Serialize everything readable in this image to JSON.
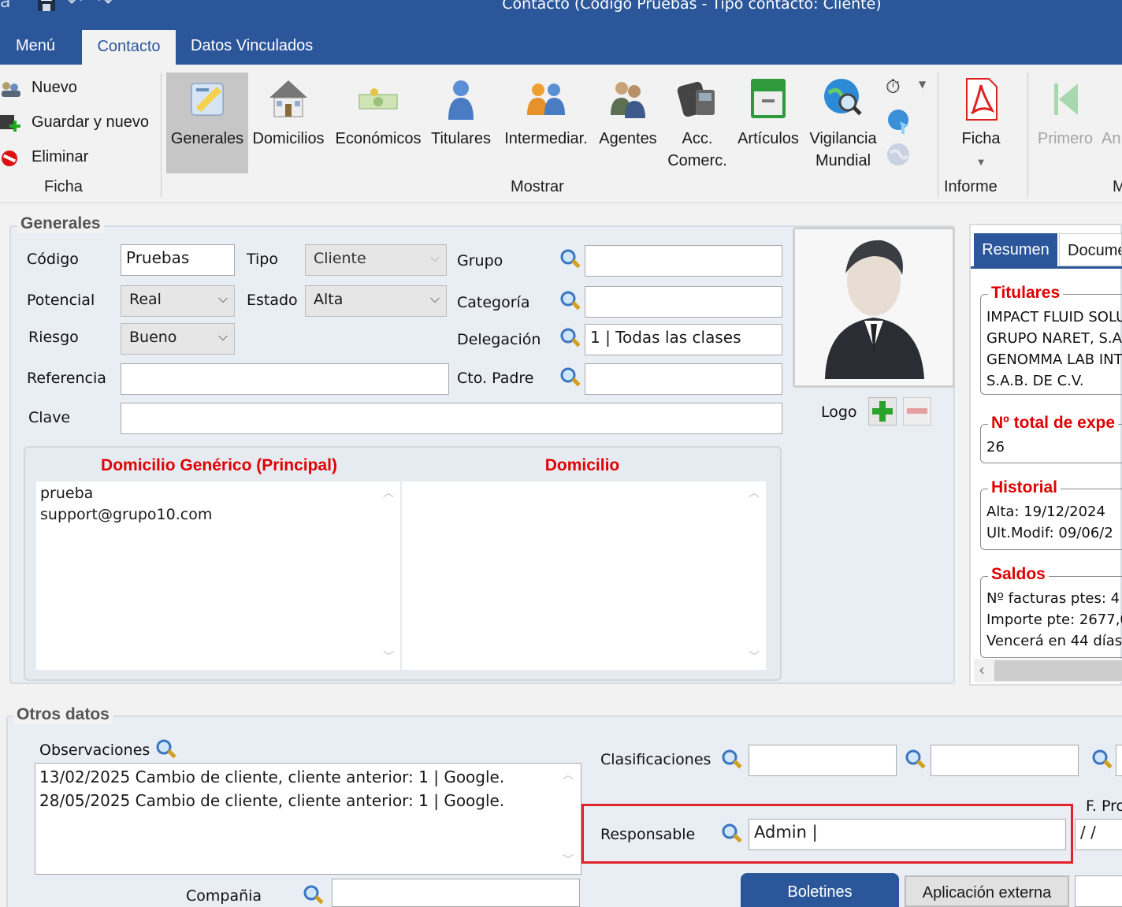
{
  "window": {
    "title": "Contacto (Código Pruebas - Tipo contacto: Cliente)"
  },
  "tabs": [
    {
      "label": "Menú"
    },
    {
      "label": "Contacto"
    },
    {
      "label": "Datos Vinculados"
    }
  ],
  "ribbon": {
    "ficha": {
      "nuevo": "Nuevo",
      "guardar_nuevo": "Guardar y nuevo",
      "eliminar": "Eliminar",
      "group": "Ficha"
    },
    "mostrar": {
      "group": "Mostrar",
      "items": [
        {
          "label": "Generales",
          "icon": "generales-icon"
        },
        {
          "label": "Domicilios",
          "icon": "house-icon"
        },
        {
          "label": "Económicos",
          "icon": "money-icon"
        },
        {
          "label": "Titulares",
          "icon": "person-icon"
        },
        {
          "label": "Intermediar.",
          "icon": "people-icon"
        },
        {
          "label": "Agentes",
          "icon": "agents-icon"
        },
        {
          "label": "Acc.",
          "label2": "Comerc.",
          "icon": "phone-icon"
        },
        {
          "label": "Artículos",
          "icon": "drawer-icon"
        },
        {
          "label": "Vigilancia",
          "label2": "Mundial",
          "icon": "globe-search-icon"
        }
      ]
    },
    "informe": {
      "ficha": "Ficha",
      "group": "Informe"
    },
    "nav": {
      "primero": "Primero",
      "anterior": "An",
      "group": "M"
    }
  },
  "generales": {
    "title": "Generales",
    "codigo_label": "Código",
    "codigo_value": "Pruebas",
    "tipo_label": "Tipo",
    "tipo_value": "Cliente",
    "grupo_label": "Grupo",
    "potencial_label": "Potencial",
    "potencial_value": "Real",
    "estado_label": "Estado",
    "estado_value": "Alta",
    "categoria_label": "Categoría",
    "riesgo_label": "Riesgo",
    "riesgo_value": "Bueno",
    "delegacion_label": "Delegación",
    "delegacion_value": "1 | Todas las clases",
    "referencia_label": "Referencia",
    "cto_padre_label": "Cto. Padre",
    "clave_label": "Clave",
    "logo_label": "Logo",
    "domicilio_generico_title": "Domicilio Genérico (Principal)",
    "domicilio_generico_lines": [
      "prueba",
      "support@grupo10.com"
    ],
    "domicilio_title": "Domicilio"
  },
  "summary": {
    "tabs": [
      "Resumen",
      "Docume"
    ],
    "titulares_title": "Titulares",
    "titulares_lines": [
      "IMPACT FLUID SOLU",
      "GRUPO NARET, S.A.",
      "GENOMMA LAB INT",
      "S.A.B. DE C.V."
    ],
    "total_title": "Nº total de expe",
    "total_value": "26",
    "historial_title": "Historial",
    "alta": "Alta: 19/12/2024",
    "ult_modif": "Ult.Modif: 09/06/2",
    "saldos_title": "Saldos",
    "facturas": "Nº facturas ptes: 4",
    "importe": "Importe pte: 2677,0",
    "vencera": "Vencerá en 44 días"
  },
  "otros": {
    "title": "Otros datos",
    "observaciones_label": "Observaciones",
    "observaciones_lines": [
      "13/02/2025 Cambio de cliente, cliente anterior: 1 | Google.",
      "28/05/2025 Cambio de cliente, cliente anterior: 1 | Google."
    ],
    "clasificaciones_label": "Clasificaciones",
    "f_pro_label": "F. Pro",
    "responsable_label": "Responsable",
    "responsable_value": "Admin |",
    "fecha_value": " /  /",
    "compania_label": "Compañia",
    "boletines": "Boletines",
    "aplicacion_externa": "Aplicación externa"
  },
  "colors": {
    "accent": "#2b579a",
    "highlight_box": "#e0242c",
    "section_red": "#e00000"
  }
}
